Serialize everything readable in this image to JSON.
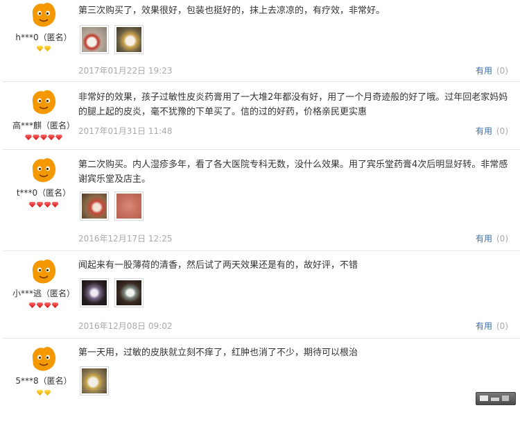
{
  "reviews": [
    {
      "user": "h***0（匿名）",
      "badges": [
        "gold",
        "gold"
      ],
      "text": "第三次购买了，效果很好，包装也挺好的，抹上去凉凉的，有疗效，非常好。",
      "date": "2017年01月22日 19:23",
      "photo_count": 2,
      "useful_label": "有用",
      "useful_count": "(0)"
    },
    {
      "user": "高***麒（匿名）",
      "badges": [
        "red",
        "red",
        "red",
        "red",
        "red"
      ],
      "text": "非常好的效果，孩子过敏性皮炎药膏用了一大堆2年都没有好，用了一个月奇迹般的好了哦。过年回老家妈妈的腿上起的皮炎，毫不犹豫的下单买了。信的过的好药，价格亲民更实惠",
      "date": "2017年01月31日 11:48",
      "photo_count": 0,
      "useful_label": "有用",
      "useful_count": "(0)"
    },
    {
      "user": "t***0（匿名）",
      "badges": [
        "red",
        "red",
        "red",
        "red"
      ],
      "text": "第二次购买。内人湿疹多年，看了各大医院专科无数，没什么效果。用了宾乐堂药膏4次后明显好转。非常感谢宾乐堂及店主。",
      "date": "2016年12月17日 12:25",
      "photo_count": 2,
      "useful_label": "有用",
      "useful_count": "(0)"
    },
    {
      "user": "小***逃（匿名）",
      "badges": [
        "red",
        "red",
        "red",
        "red"
      ],
      "text": "闻起来有一股薄荷的清香，然后试了两天效果还是有的，故好评，不错",
      "date": "2016年12月08日 09:02",
      "photo_count": 2,
      "useful_label": "有用",
      "useful_count": "(0)"
    },
    {
      "user": "5***8（匿名）",
      "badges": [
        "gold",
        "gold"
      ],
      "text": "第一天用，过敏的皮肤就立刻不痒了，红肿也消了不少，期待可以根治",
      "photo_count": 1
    }
  ],
  "colors": {
    "useful_link": "#3b6ea5",
    "date_text": "#a9a9a9",
    "separator": "#e4e4e4",
    "avatar_orange": "#f39800"
  }
}
